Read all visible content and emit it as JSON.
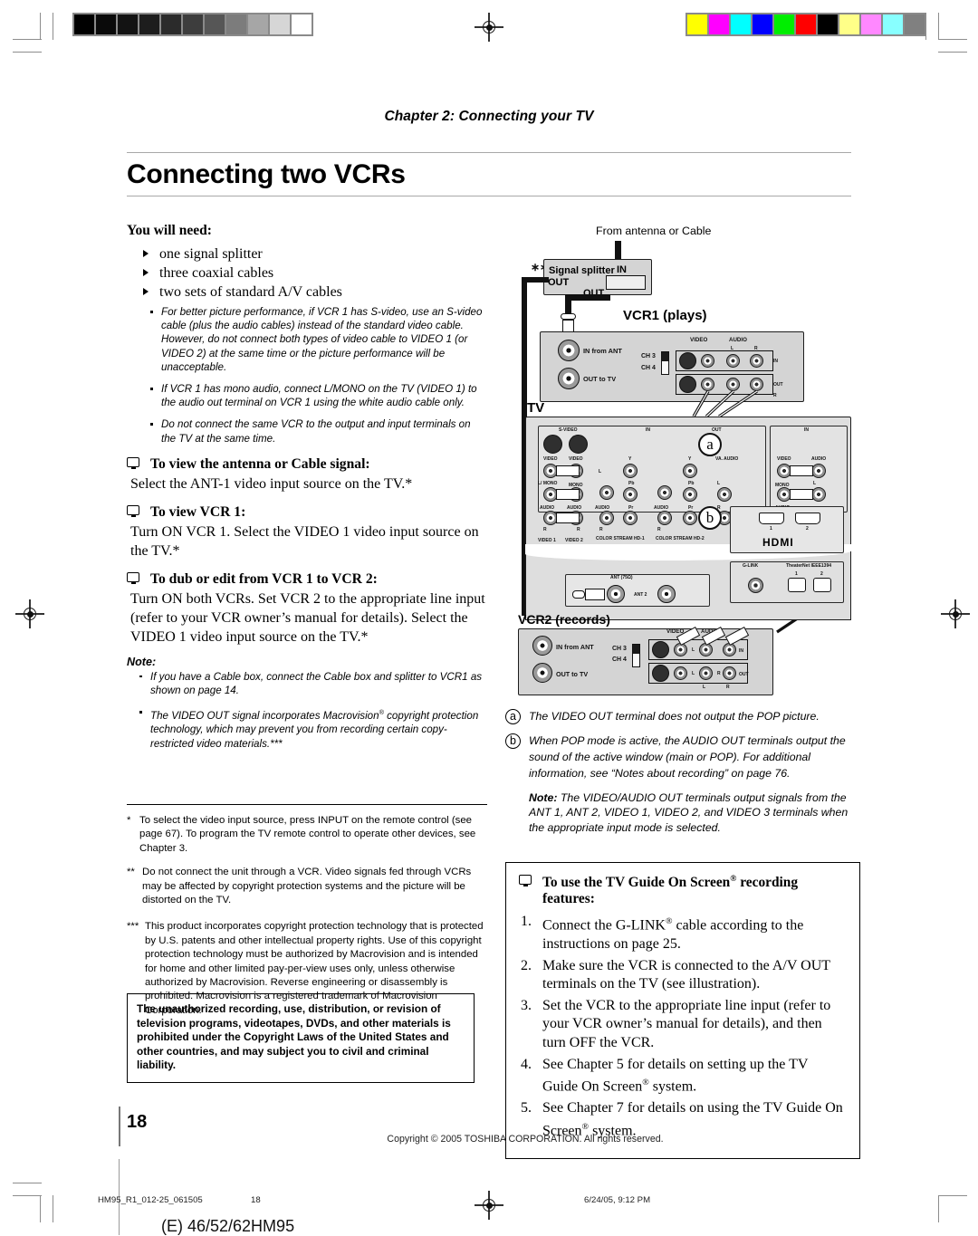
{
  "header": {
    "chapter": "Chapter 2: Connecting your TV",
    "title": "Connecting two VCRs"
  },
  "left": {
    "needs_heading": "You will need:",
    "needs_items": [
      "one signal splitter",
      "three coaxial cables",
      "two sets of standard A/V cables"
    ],
    "italic_notes": [
      "For better picture performance, if VCR 1 has S-video, use an S-video cable (plus the audio cables) instead of the standard video cable. However, do not connect both types of video cable to VIDEO 1 (or VIDEO 2) at the same time or the picture performance will be unacceptable.",
      "If VCR 1 has mono audio, connect L/MONO on the TV (VIDEO 1) to the audio out terminal on VCR 1 using the white audio cable only.",
      "Do not connect the same VCR to the output and input terminals on the TV at the same time."
    ],
    "sections": [
      {
        "heading": "To view the antenna or Cable signal:",
        "body": "Select the ANT-1 video input source on the TV.*"
      },
      {
        "heading": "To view VCR 1:",
        "body": "Turn ON VCR 1. Select the VIDEO 1 video input source on the TV.*"
      },
      {
        "heading": "To dub or edit from VCR 1 to VCR 2:",
        "body": "Turn ON both VCRs. Set VCR 2 to the appropriate line input (refer to your VCR owner’s manual for details). Select the VIDEO 1 video input source on the TV.*"
      }
    ],
    "note_label": "Note:",
    "note_items": [
      "If you have a Cable box, connect the Cable box and splitter to VCR1 as shown on page 14.",
      "The VIDEO OUT signal incorporates Macrovision® copyright protection technology, which may prevent you from recording certain copy-restricted video materials.***"
    ],
    "footnotes": [
      {
        "mark": "*",
        "text": "To select the video input source, press INPUT on the remote control (see page 67). To program the TV remote control to operate other devices, see Chapter 3."
      },
      {
        "mark": "**",
        "text": "Do not connect the unit through a VCR. Video signals fed through VCRs may be affected by copyright protection systems and the picture will be distorted on the TV."
      },
      {
        "mark": "***",
        "text": "This product incorporates copyright protection technology that is protected by U.S. patents and other intellectual property rights. Use of this copyright protection technology must be authorized by Macrovision and is intended for home and other limited pay-per-view uses only, unless otherwise authorized by Macrovision. Reverse engineering or disassembly is prohibited. Macrovision is a registered trademark of Macrovision Corporation."
      }
    ],
    "legal_box": "The unauthorized recording, use, distribution, or revision of television programs, videotapes, DVDs, and other materials is prohibited under the Copyright Laws of the United States and other countries, and may subject you to civil and criminal liability."
  },
  "diagram": {
    "source_label": "From antenna or Cable",
    "asterisks": "∗∗",
    "splitter": {
      "title": "Signal splitter",
      "in": "IN",
      "out1": "OUT",
      "out2": "OUT"
    },
    "vcr1": {
      "title": "VCR1 (plays)",
      "in_from_ant": "IN from ANT",
      "out_to_tv": "OUT to TV",
      "ch3": "CH 3",
      "ch4": "CH 4",
      "video": "VIDEO",
      "audio": "AUDIO",
      "l": "L",
      "r": "R",
      "in": "IN",
      "out": "OUT"
    },
    "tv": {
      "title": "TV",
      "svideo": "S-VIDEO",
      "in": "IN",
      "out": "OUT",
      "video": "VIDEO",
      "l_mono": "L/ MONO",
      "mono": "MONO",
      "audio": "AUDIO",
      "r": "R",
      "l": "L",
      "y": "Y",
      "pb": "Pb",
      "pr": "Pr",
      "video1": "VIDEO 1",
      "video2": "VIDEO 2",
      "colorstream1": "COLOR STREAM HD-1",
      "colorstream2": "COLOR STREAM HD-2",
      "va_audio": "VA. AUDIO",
      "hdmi": "HDMI",
      "hdmi1": "1",
      "hdmi2": "2",
      "glink": "G-LINK",
      "thinternet": "TheaterNet IEEE1394",
      "tn1": "1",
      "tn2": "2",
      "ant75": "ANT (75Ω)",
      "ant2": "ANT 2"
    },
    "vcr2": {
      "title": "VCR2 (records)",
      "in_from_ant": "IN from ANT",
      "out_to_tv": "OUT to TV",
      "ch3": "CH 3",
      "ch4": "CH 4",
      "video": "VIDEO",
      "audio": "AUDIO",
      "l": "L",
      "r": "R",
      "in": "IN",
      "out": "OUT"
    },
    "marker_a": "a",
    "marker_b": "b"
  },
  "right": {
    "callouts": [
      {
        "mark": "a",
        "text": "The VIDEO OUT terminal does not output the POP picture."
      },
      {
        "mark": "b",
        "text": "When POP mode is active, the AUDIO OUT terminals output the sound of the active window (main or POP). For additional information, see “Notes about recording” on page 76."
      }
    ],
    "note_label": "Note:",
    "note_text": "The VIDEO/AUDIO OUT terminals output signals from the ANT 1, ANT 2, VIDEO 1, VIDEO 2, and VIDEO 3 terminals when the appropriate input mode is selected.",
    "guide_heading": "To use the TV Guide On Screen® recording features:",
    "guide_steps": [
      "Connect the G-LINK® cable according to the instructions on page 25.",
      "Make sure the VCR is connected to the A/V OUT terminals on the TV (see illustration).",
      "Set the VCR to the appropriate line input (refer to your VCR owner’s manual for details), and then turn OFF the VCR.",
      "See Chapter 5 for details on setting up the TV Guide On Screen® system.",
      "See Chapter 7 for details on using the TV Guide On Screen® system."
    ]
  },
  "footer": {
    "page_number": "18",
    "copyright": "Copyright © 2005 TOSHIBA CORPORATION. All rights reserved.",
    "file_id": "HM95_R1_012-25_061505",
    "strip_page": "18",
    "timestamp": "6/24/05, 9:12 PM",
    "model": "(E) 46/52/62HM95"
  },
  "colors": {
    "gray_bars": [
      "#000000",
      "#0a0a0a",
      "#131313",
      "#1d1d1d",
      "#2b2b2b",
      "#3d3d3d",
      "#565656",
      "#7c7c7c",
      "#a6a6a6",
      "#d6d6d6",
      "#ffffff"
    ],
    "color_bars": [
      "#ffff00",
      "#ff00ff",
      "#00ffff",
      "#0000ff",
      "#00ee00",
      "#ff0000",
      "#000000",
      "#ffff88",
      "#ff88ff",
      "#88ffff",
      "#808080"
    ]
  }
}
